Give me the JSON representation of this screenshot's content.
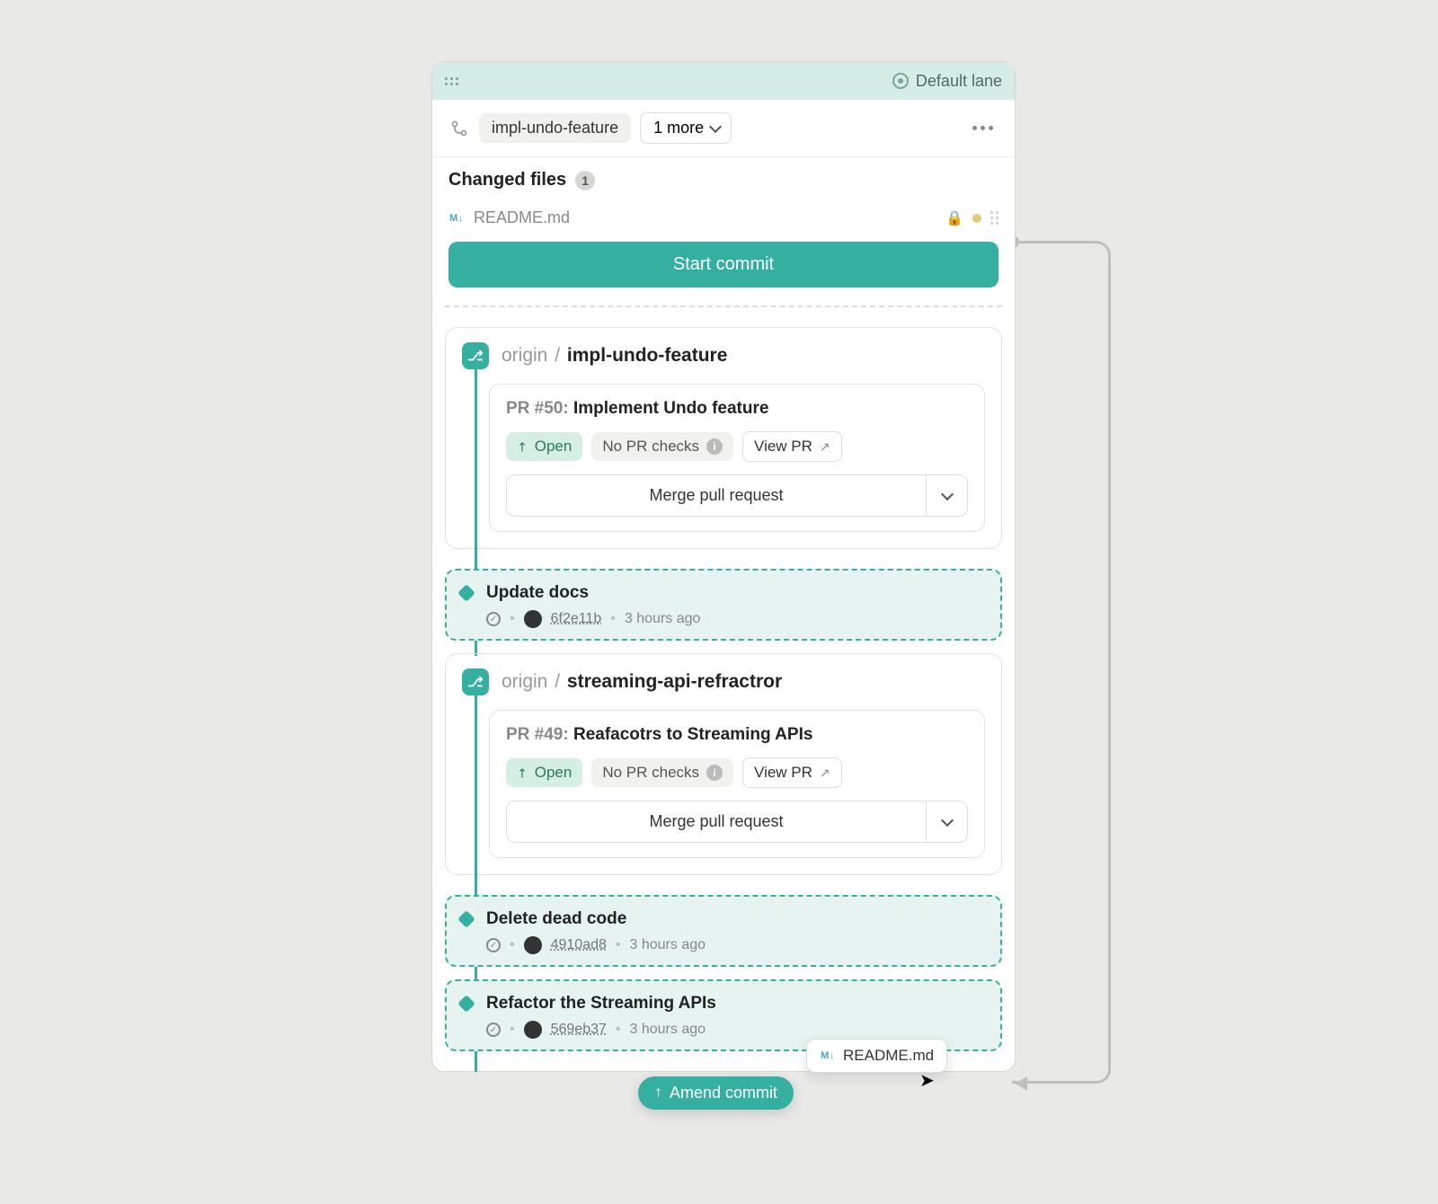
{
  "lane": {
    "label": "Default lane"
  },
  "branch_bar": {
    "branch": "impl-undo-feature",
    "more": "1 more"
  },
  "changed_files": {
    "title": "Changed files",
    "count": "1",
    "file": "README.md"
  },
  "start_commit": "Start commit",
  "pr1": {
    "origin": "origin",
    "branch": "impl-undo-feature",
    "pr_num": "PR #50:",
    "pr_title": "Implement Undo feature",
    "open": "Open",
    "checks": "No PR checks",
    "view": "View PR",
    "merge": "Merge pull request"
  },
  "commit1": {
    "title": "Update docs",
    "sha": "6f2e11b",
    "time": "3 hours ago"
  },
  "pr2": {
    "origin": "origin",
    "branch": "streaming-api-refractror",
    "pr_num": "PR #49:",
    "pr_title": "Reafacotrs to Streaming APIs",
    "open": "Open",
    "checks": "No PR checks",
    "view": "View PR",
    "merge": "Merge pull request"
  },
  "commit2": {
    "title": "Delete dead code",
    "sha": "4910ad8",
    "time": "3 hours ago"
  },
  "commit3": {
    "title": "Refactor the Streaming APIs",
    "sha": "569eb37",
    "time": "3 hours ago"
  },
  "drag": {
    "file": "README.md",
    "amend": "Amend commit"
  }
}
